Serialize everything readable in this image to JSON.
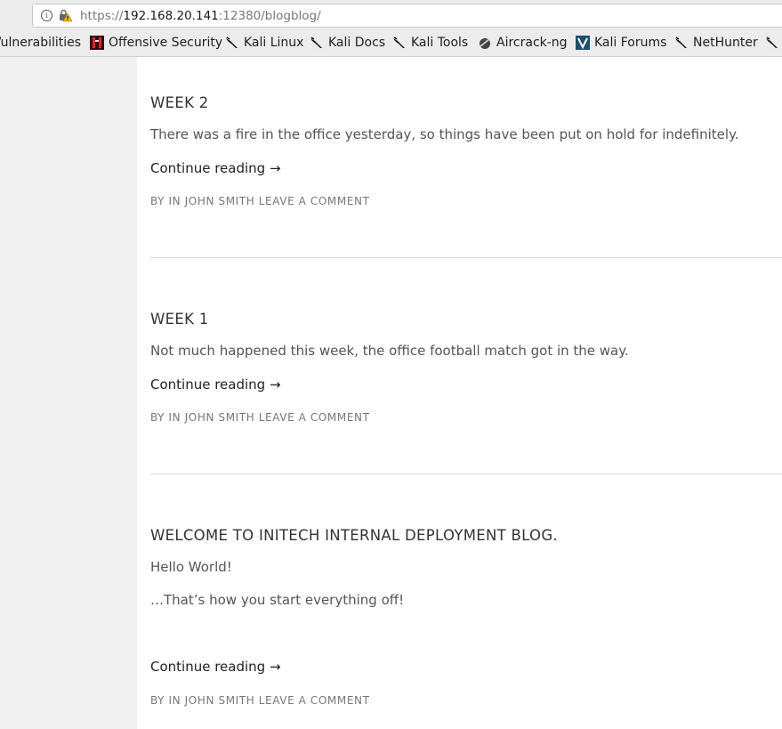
{
  "browser": {
    "url_prefix": "https://",
    "url_host": "192.168.20.141",
    "url_rest": ":12380/blogblog/",
    "info_icon": "i",
    "bookmarks": [
      {
        "label": "Vulnerabilities",
        "icon": "none"
      },
      {
        "label": "Offensive Security",
        "icon": "offsec-icon"
      },
      {
        "label": "Kali Linux",
        "icon": "kali-dragon-icon"
      },
      {
        "label": "Kali Docs",
        "icon": "kali-dragon-icon"
      },
      {
        "label": "Kali Tools",
        "icon": "kali-dragon-icon"
      },
      {
        "label": "Aircrack-ng",
        "icon": "aircrack-icon"
      },
      {
        "label": "Kali Forums",
        "icon": "kali-forums-icon"
      },
      {
        "label": "NetHunter",
        "icon": "kali-dragon-icon"
      }
    ]
  },
  "posts": [
    {
      "title": "WEEK 2",
      "paragraphs": [
        "There was a fire in the office yesterday, so things have been put on hold for indefinitely."
      ],
      "continue": "Continue reading →",
      "meta_by": "BY",
      "meta_in": "IN",
      "meta_author": "JOHN SMITH",
      "meta_comment": "LEAVE A COMMENT"
    },
    {
      "title": "WEEK 1",
      "paragraphs": [
        "Not much happened this week, the office football match got in the way."
      ],
      "continue": "Continue reading →",
      "meta_by": "BY",
      "meta_in": "IN",
      "meta_author": "JOHN SMITH",
      "meta_comment": "LEAVE A COMMENT"
    },
    {
      "title": "WELCOME TO INITECH INTERNAL DEPLOYMENT BLOG.",
      "paragraphs": [
        "Hello World!",
        "…That’s how you start everything off!"
      ],
      "continue": "Continue reading →",
      "meta_by": "BY",
      "meta_in": "IN",
      "meta_author": "JOHN SMITH",
      "meta_comment": "LEAVE A COMMENT"
    }
  ],
  "colors": {
    "sidebar_bg": "#f1f1f1",
    "chrome_bg": "#ececec",
    "title": "#333333",
    "body_text": "#555555",
    "meta_text": "#777777"
  }
}
